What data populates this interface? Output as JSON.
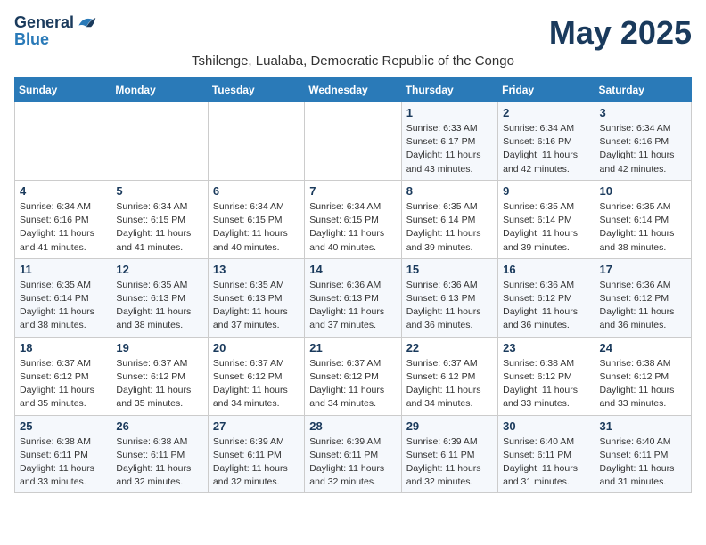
{
  "header": {
    "logo_line1": "General",
    "logo_line2": "Blue",
    "month_title": "May 2025",
    "location": "Tshilenge, Lualaba, Democratic Republic of the Congo"
  },
  "weekdays": [
    "Sunday",
    "Monday",
    "Tuesday",
    "Wednesday",
    "Thursday",
    "Friday",
    "Saturday"
  ],
  "weeks": [
    [
      {
        "day": "",
        "detail": ""
      },
      {
        "day": "",
        "detail": ""
      },
      {
        "day": "",
        "detail": ""
      },
      {
        "day": "",
        "detail": ""
      },
      {
        "day": "1",
        "detail": "Sunrise: 6:33 AM\nSunset: 6:17 PM\nDaylight: 11 hours\nand 43 minutes."
      },
      {
        "day": "2",
        "detail": "Sunrise: 6:34 AM\nSunset: 6:16 PM\nDaylight: 11 hours\nand 42 minutes."
      },
      {
        "day": "3",
        "detail": "Sunrise: 6:34 AM\nSunset: 6:16 PM\nDaylight: 11 hours\nand 42 minutes."
      }
    ],
    [
      {
        "day": "4",
        "detail": "Sunrise: 6:34 AM\nSunset: 6:16 PM\nDaylight: 11 hours\nand 41 minutes."
      },
      {
        "day": "5",
        "detail": "Sunrise: 6:34 AM\nSunset: 6:15 PM\nDaylight: 11 hours\nand 41 minutes."
      },
      {
        "day": "6",
        "detail": "Sunrise: 6:34 AM\nSunset: 6:15 PM\nDaylight: 11 hours\nand 40 minutes."
      },
      {
        "day": "7",
        "detail": "Sunrise: 6:34 AM\nSunset: 6:15 PM\nDaylight: 11 hours\nand 40 minutes."
      },
      {
        "day": "8",
        "detail": "Sunrise: 6:35 AM\nSunset: 6:14 PM\nDaylight: 11 hours\nand 39 minutes."
      },
      {
        "day": "9",
        "detail": "Sunrise: 6:35 AM\nSunset: 6:14 PM\nDaylight: 11 hours\nand 39 minutes."
      },
      {
        "day": "10",
        "detail": "Sunrise: 6:35 AM\nSunset: 6:14 PM\nDaylight: 11 hours\nand 38 minutes."
      }
    ],
    [
      {
        "day": "11",
        "detail": "Sunrise: 6:35 AM\nSunset: 6:14 PM\nDaylight: 11 hours\nand 38 minutes."
      },
      {
        "day": "12",
        "detail": "Sunrise: 6:35 AM\nSunset: 6:13 PM\nDaylight: 11 hours\nand 38 minutes."
      },
      {
        "day": "13",
        "detail": "Sunrise: 6:35 AM\nSunset: 6:13 PM\nDaylight: 11 hours\nand 37 minutes."
      },
      {
        "day": "14",
        "detail": "Sunrise: 6:36 AM\nSunset: 6:13 PM\nDaylight: 11 hours\nand 37 minutes."
      },
      {
        "day": "15",
        "detail": "Sunrise: 6:36 AM\nSunset: 6:13 PM\nDaylight: 11 hours\nand 36 minutes."
      },
      {
        "day": "16",
        "detail": "Sunrise: 6:36 AM\nSunset: 6:12 PM\nDaylight: 11 hours\nand 36 minutes."
      },
      {
        "day": "17",
        "detail": "Sunrise: 6:36 AM\nSunset: 6:12 PM\nDaylight: 11 hours\nand 36 minutes."
      }
    ],
    [
      {
        "day": "18",
        "detail": "Sunrise: 6:37 AM\nSunset: 6:12 PM\nDaylight: 11 hours\nand 35 minutes."
      },
      {
        "day": "19",
        "detail": "Sunrise: 6:37 AM\nSunset: 6:12 PM\nDaylight: 11 hours\nand 35 minutes."
      },
      {
        "day": "20",
        "detail": "Sunrise: 6:37 AM\nSunset: 6:12 PM\nDaylight: 11 hours\nand 34 minutes."
      },
      {
        "day": "21",
        "detail": "Sunrise: 6:37 AM\nSunset: 6:12 PM\nDaylight: 11 hours\nand 34 minutes."
      },
      {
        "day": "22",
        "detail": "Sunrise: 6:37 AM\nSunset: 6:12 PM\nDaylight: 11 hours\nand 34 minutes."
      },
      {
        "day": "23",
        "detail": "Sunrise: 6:38 AM\nSunset: 6:12 PM\nDaylight: 11 hours\nand 33 minutes."
      },
      {
        "day": "24",
        "detail": "Sunrise: 6:38 AM\nSunset: 6:12 PM\nDaylight: 11 hours\nand 33 minutes."
      }
    ],
    [
      {
        "day": "25",
        "detail": "Sunrise: 6:38 AM\nSunset: 6:11 PM\nDaylight: 11 hours\nand 33 minutes."
      },
      {
        "day": "26",
        "detail": "Sunrise: 6:38 AM\nSunset: 6:11 PM\nDaylight: 11 hours\nand 32 minutes."
      },
      {
        "day": "27",
        "detail": "Sunrise: 6:39 AM\nSunset: 6:11 PM\nDaylight: 11 hours\nand 32 minutes."
      },
      {
        "day": "28",
        "detail": "Sunrise: 6:39 AM\nSunset: 6:11 PM\nDaylight: 11 hours\nand 32 minutes."
      },
      {
        "day": "29",
        "detail": "Sunrise: 6:39 AM\nSunset: 6:11 PM\nDaylight: 11 hours\nand 32 minutes."
      },
      {
        "day": "30",
        "detail": "Sunrise: 6:40 AM\nSunset: 6:11 PM\nDaylight: 11 hours\nand 31 minutes."
      },
      {
        "day": "31",
        "detail": "Sunrise: 6:40 AM\nSunset: 6:11 PM\nDaylight: 11 hours\nand 31 minutes."
      }
    ]
  ]
}
